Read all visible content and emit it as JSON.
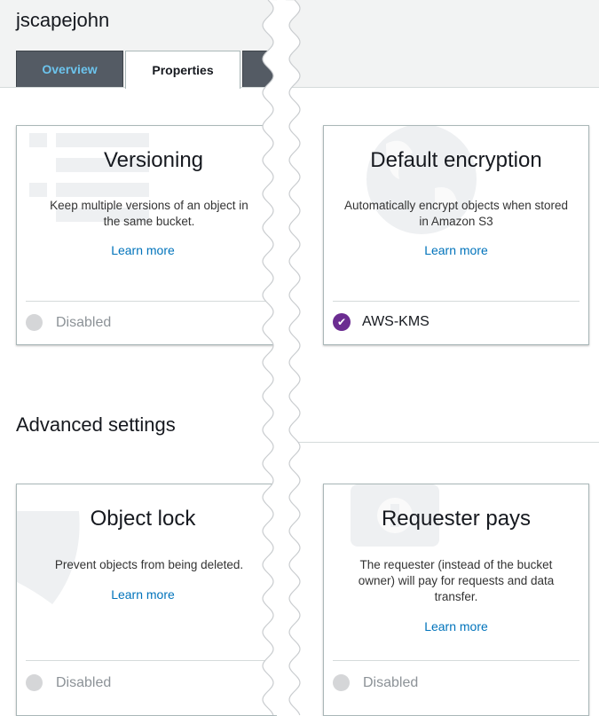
{
  "bucket": {
    "name": "jscapejohn"
  },
  "tabs": [
    {
      "label": "Overview",
      "active": false
    },
    {
      "label": "Properties",
      "active": true
    }
  ],
  "cards": {
    "versioning": {
      "title": "Versioning",
      "description": "Keep multiple versions of an object in the same bucket.",
      "link": "Learn more",
      "status": "Disabled"
    },
    "default_encryption": {
      "title": "Default encryption",
      "description": "Automatically encrypt objects when stored in Amazon S3",
      "link": "Learn more",
      "status": "AWS-KMS"
    },
    "object_lock": {
      "title": "Object lock",
      "description": "Prevent objects from being deleted.",
      "link": "Learn more",
      "status": "Disabled"
    },
    "requester_pays": {
      "title": "Requester pays",
      "description": "The requester (instead of the bucket owner) will pay for requests and data transfer.",
      "link": "Learn more",
      "status": "Disabled"
    }
  },
  "advanced": {
    "title": "Advanced settings"
  },
  "colors": {
    "accent_link": "#0073bb",
    "tab_dark": "#545b64",
    "tab_text": "#6cc4ed",
    "enabled_check": "#6b2c91",
    "callout": "#e8960c"
  },
  "icons": {
    "status_disabled": "disabled-dot-icon",
    "status_enabled": "check-icon"
  }
}
